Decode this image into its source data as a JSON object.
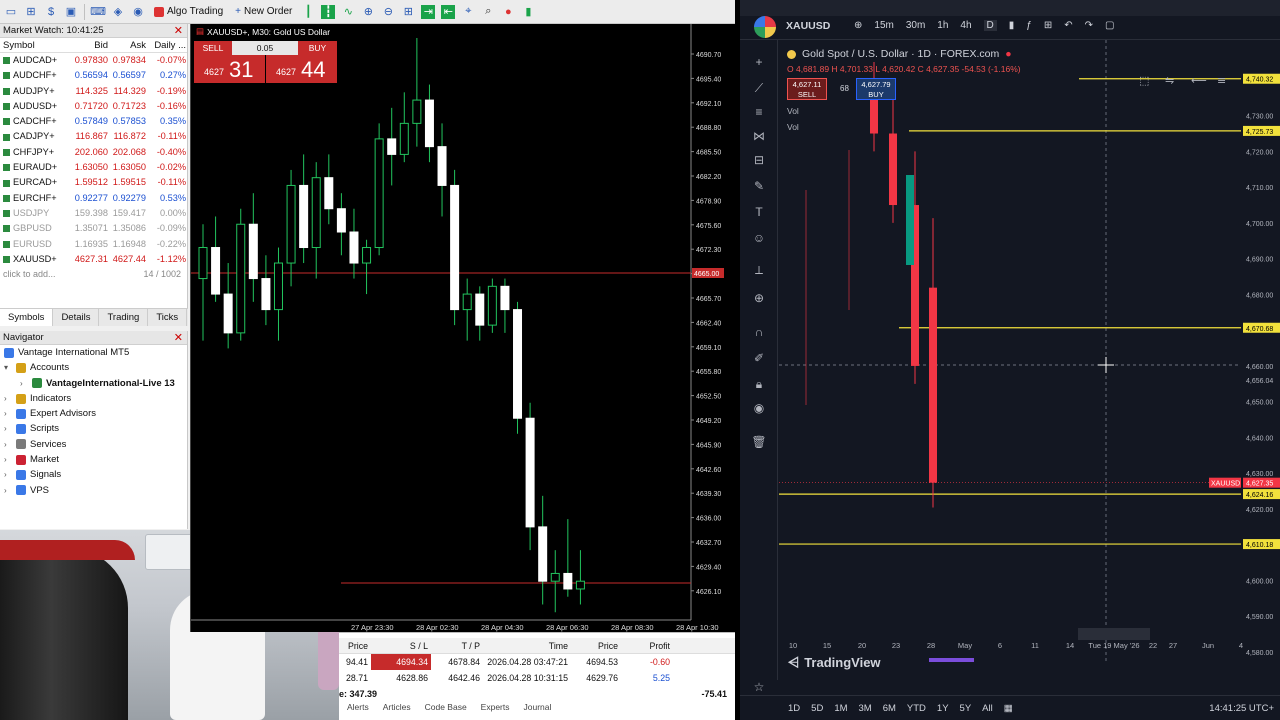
{
  "mt5": {
    "toolbar": {
      "algo_trading": "Algo Trading",
      "new_order": "New Order"
    },
    "market_watch": {
      "title": "Market Watch: 10:41:25",
      "columns": [
        "Symbol",
        "Bid",
        "Ask",
        "Daily ..."
      ],
      "rows": [
        {
          "symbol": "AUDCAD+",
          "bid": "0.97830",
          "ask": "0.97834",
          "daily": "-0.07%",
          "dir": "dn",
          "dim": false
        },
        {
          "symbol": "AUDCHF+",
          "bid": "0.56594",
          "ask": "0.56597",
          "daily": "0.27%",
          "dir": "up",
          "dim": false
        },
        {
          "symbol": "AUDJPY+",
          "bid": "114.325",
          "ask": "114.329",
          "daily": "-0.19%",
          "dir": "dn",
          "dim": false
        },
        {
          "symbol": "AUDUSD+",
          "bid": "0.71720",
          "ask": "0.71723",
          "daily": "-0.16%",
          "dir": "dn",
          "dim": false
        },
        {
          "symbol": "CADCHF+",
          "bid": "0.57849",
          "ask": "0.57853",
          "daily": "0.35%",
          "dir": "up",
          "dim": false
        },
        {
          "symbol": "CADJPY+",
          "bid": "116.867",
          "ask": "116.872",
          "daily": "-0.11%",
          "dir": "dn",
          "dim": false
        },
        {
          "symbol": "CHFJPY+",
          "bid": "202.060",
          "ask": "202.068",
          "daily": "-0.40%",
          "dir": "dn",
          "dim": false
        },
        {
          "symbol": "EURAUD+",
          "bid": "1.63050",
          "ask": "1.63050",
          "daily": "-0.02%",
          "dir": "dn",
          "dim": false
        },
        {
          "symbol": "EURCAD+",
          "bid": "1.59512",
          "ask": "1.59515",
          "daily": "-0.11%",
          "dir": "dn",
          "dim": false
        },
        {
          "symbol": "EURCHF+",
          "bid": "0.92277",
          "ask": "0.92279",
          "daily": "0.53%",
          "dir": "up",
          "dim": false
        },
        {
          "symbol": "USDJPY",
          "bid": "159.398",
          "ask": "159.417",
          "daily": "0.00%",
          "dir": "up",
          "dim": true
        },
        {
          "symbol": "GBPUSD",
          "bid": "1.35071",
          "ask": "1.35086",
          "daily": "-0.09%",
          "dir": "dn",
          "dim": true
        },
        {
          "symbol": "EURUSD",
          "bid": "1.16935",
          "ask": "1.16948",
          "daily": "-0.22%",
          "dir": "dn",
          "dim": true
        },
        {
          "symbol": "XAUUSD+",
          "bid": "4627.31",
          "ask": "4627.44",
          "daily": "-1.12%",
          "dir": "dn",
          "dim": false
        }
      ],
      "add_label": "click to add...",
      "count": "14 / 1002"
    },
    "tabs": [
      "Symbols",
      "Details",
      "Trading",
      "Ticks"
    ],
    "navigator": {
      "title": "Navigator",
      "root": "Vantage International MT5",
      "accounts": "Accounts",
      "account": "VantageInternational-Live 13",
      "items": [
        "Indicators",
        "Expert Advisors",
        "Scripts",
        "Services",
        "Market",
        "Signals",
        "VPS"
      ]
    },
    "chart": {
      "title": "XAUUSD+, M30:  Gold US Dollar",
      "sell": "SELL",
      "buy": "BUY",
      "lot": "0.05",
      "sell_small": "4627",
      "sell_big": "31",
      "buy_small": "4627",
      "buy_big": "44",
      "price_ticks": [
        "4690.70",
        "4695.40",
        "4692.10",
        "4688.80",
        "4685.50",
        "4682.20",
        "4678.90",
        "4675.60",
        "4672.30",
        "4669.00",
        "4665.70",
        "4662.40",
        "4659.10",
        "4655.80",
        "4652.50",
        "4649.20",
        "4645.90",
        "4642.60",
        "4639.30",
        "4636.00",
        "4632.70",
        "4629.40",
        "4626.10"
      ],
      "current_label": "4665.00",
      "time_labels": [
        "27 Apr 23:30",
        "28 Apr 02:30",
        "28 Apr 04:30",
        "28 Apr 06:30",
        "28 Apr 08:30",
        "28 Apr 10:30"
      ]
    },
    "trades": {
      "columns": [
        "Price",
        "S / L",
        "T / P",
        "Time",
        "Price",
        "Profit"
      ],
      "rows": [
        {
          "price": "94.41",
          "sl": "4694.34",
          "tp": "4678.84",
          "time": "2026.04.28 03:47:21",
          "cur": "4694.53",
          "profit": "-0.60"
        },
        {
          "price": "28.71",
          "sl": "4628.86",
          "tp": "4642.46",
          "time": "2026.04.28 10:31:15",
          "cur": "4629.76",
          "profit": "5.25"
        }
      ],
      "balance": "e: 347.39",
      "total": "-75.41",
      "bottom_tabs": [
        "Alerts",
        "Articles",
        "Code Base",
        "Experts",
        "Journal"
      ]
    }
  },
  "tv": {
    "symbol": "XAUUSD",
    "timeframes": [
      "15m",
      "30m",
      "1h",
      "4h",
      "D"
    ],
    "legend": "Gold Spot / U.S. Dollar · 1D · FOREX.com",
    "ohlc": "O 4,681.89  H 4,701.33  L 4,620.42  C 4,627.35  -54.53 (-1.16%)",
    "sell_price": "4,627.11",
    "sell_label": "SELL",
    "buy_price": "4,627.79",
    "buy_label": "BUY",
    "spread": "68",
    "vol_labels": [
      "Vol",
      "Vol"
    ],
    "price_axis": [
      "4,740.32",
      "4,730.00",
      "4,725.73",
      "4,720.00",
      "4,710.00",
      "4,700.00",
      "4,690.00",
      "4,680.00",
      "4,670.68",
      "4,660.00",
      "4,656.04",
      "4,650.00",
      "4,640.00",
      "4,630.00",
      "4,627.35",
      "4,624.16",
      "4,620.00",
      "4,610.18",
      "4,600.00",
      "4,590.00",
      "4,580.00"
    ],
    "xauusd_tag": "XAUUSD",
    "date_axis": [
      "10",
      "15",
      "20",
      "23",
      "28",
      "May",
      "6",
      "11",
      "14",
      "Tue 19 May '26",
      "22",
      "27",
      "Jun",
      "4"
    ],
    "brand": "TradingView",
    "ranges": [
      "1D",
      "5D",
      "1M",
      "3M",
      "6M",
      "YTD",
      "1Y",
      "5Y",
      "All"
    ],
    "clock": "14:41:25 UTC+"
  },
  "colors": {
    "bull_green": "#22c55e",
    "tv_red": "#f23645",
    "tv_yellow": "#f2e13c",
    "mt5_red": "#c62b2b"
  },
  "chart_data": [
    {
      "type": "candlestick",
      "title": "XAUUSD+, M30:  Gold US Dollar",
      "ylim": [
        4624.0,
        4699.0
      ],
      "x": [
        "27 Apr 23:30",
        "28 Apr 02:30",
        "28 Apr 04:30",
        "28 Apr 06:30",
        "28 Apr 08:30",
        "28 Apr 10:30"
      ],
      "ohlc": [
        [
          4668,
          4675,
          4660,
          4672
        ],
        [
          4672,
          4676,
          4665,
          4666
        ],
        [
          4666,
          4670,
          4659,
          4661
        ],
        [
          4661,
          4677,
          4660,
          4675
        ],
        [
          4675,
          4679,
          4665,
          4668
        ],
        [
          4668,
          4671,
          4662,
          4664
        ],
        [
          4664,
          4672,
          4660,
          4670
        ],
        [
          4670,
          4682,
          4667,
          4680
        ],
        [
          4680,
          4684,
          4670,
          4672
        ],
        [
          4672,
          4683,
          4668,
          4681
        ],
        [
          4681,
          4684,
          4675,
          4677
        ],
        [
          4677,
          4679,
          4671,
          4674
        ],
        [
          4674,
          4677,
          4668,
          4670
        ],
        [
          4670,
          4673,
          4666,
          4672
        ],
        [
          4672,
          4688,
          4671,
          4686
        ],
        [
          4686,
          4690,
          4680,
          4684
        ],
        [
          4684,
          4692,
          4683,
          4688
        ],
        [
          4688,
          4699,
          4685,
          4691
        ],
        [
          4691,
          4693,
          4683,
          4685
        ],
        [
          4685,
          4688,
          4676,
          4680
        ],
        [
          4680,
          4682,
          4662,
          4664
        ],
        [
          4664,
          4668,
          4660,
          4666
        ],
        [
          4666,
          4667,
          4660,
          4662
        ],
        [
          4662,
          4668,
          4661,
          4667
        ],
        [
          4667,
          4668,
          4661,
          4664
        ],
        [
          4664,
          4665,
          4648,
          4650
        ],
        [
          4650,
          4652,
          4633,
          4636
        ],
        [
          4636,
          4640,
          4626,
          4629
        ],
        [
          4629,
          4633,
          4625,
          4630
        ],
        [
          4630,
          4637,
          4627,
          4628
        ],
        [
          4628,
          4633,
          4626,
          4629
        ]
      ]
    },
    {
      "type": "candlestick",
      "title": "Gold Spot / U.S. Dollar · 1D · FOREX.com",
      "ylim": [
        4580.0,
        4745.0
      ],
      "ohlc": [
        [
          4735,
          4745,
          4720,
          4725
        ],
        [
          4725,
          4740,
          4700,
          4705
        ],
        [
          4705,
          4720,
          4655,
          4660
        ],
        [
          4681.89,
          4701.33,
          4620.42,
          4627.35
        ]
      ],
      "horizontal_levels": [
        4740.32,
        4725.73,
        4670.68,
        4624.16,
        4610.18
      ]
    }
  ]
}
